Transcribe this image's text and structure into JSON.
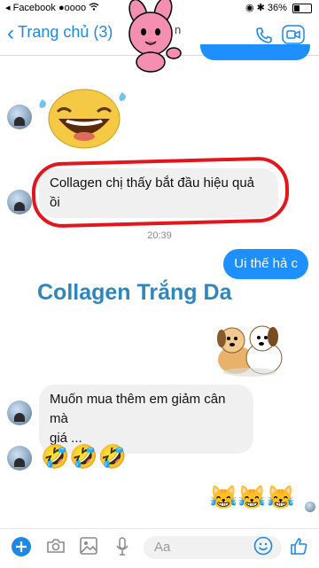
{
  "status_bar": {
    "carrier": "Facebook",
    "signal": "●oooo",
    "battery": "36%",
    "battery_level": 0.36
  },
  "nav": {
    "back_label": "Trang chủ (3)",
    "title_fragment": "n"
  },
  "messages": [
    {
      "from": "them",
      "text": "Collagen chị thấy bắt đầu hiệu quả ồi",
      "lines": [
        "Collagen chị thấy bắt đầu hiệu quả",
        "ồi"
      ]
    },
    {
      "type": "timestamp",
      "text": "20:39"
    },
    {
      "from": "me",
      "text": "Ui thế hả c"
    },
    {
      "from": "them",
      "text": "Muốn mua thêm em giảm cân mà giá ...",
      "lines": [
        "Muốn mua thêm em giảm cân mà",
        "giá ..."
      ]
    }
  ],
  "emoji_rows": {
    "them_laughing": "🤣🤣🤣",
    "me_crying_laugh": "😹😹😹"
  },
  "watermark": "Collagen Trắng Da",
  "composer": {
    "placeholder": "Aa"
  },
  "icons": [
    "back-chevron-icon",
    "phone-icon",
    "video-icon",
    "plus-icon",
    "camera-icon",
    "gallery-icon",
    "microphone-icon",
    "smile-icon",
    "like-icon"
  ],
  "colors": {
    "accent": "#1e88e5",
    "outgoing_bubble": "#1e8fff",
    "incoming_bubble": "#f0f0f0",
    "highlight_circle": "#e3161d",
    "watermark": "#2e86c1"
  }
}
